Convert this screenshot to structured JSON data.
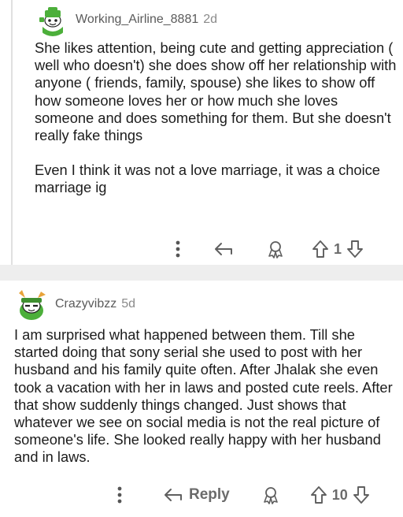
{
  "comments": [
    {
      "username": "Working_Airline_8881",
      "age": "2d",
      "paragraphs": [
        "She likes attention, being cute and getting appreciation ( well who doesn't) she does show off her relationship with anyone ( friends, family, spouse) she likes to show off how someone loves her or how much she loves someone and does something for them. But she doesn't really fake things",
        "Even I think it was not a love marriage, it was a choice marriage ig"
      ],
      "reply_label": "",
      "score": "1",
      "icons": {
        "more": "more-vertical-icon",
        "reply": "reply-arrow-icon",
        "award": "award-icon",
        "upvote": "upvote-arrow-icon",
        "downvote": "downvote-arrow-icon"
      }
    },
    {
      "username": "Crazyvibzz",
      "age": "5d",
      "paragraphs": [
        "I am surprised what happened between them. Till she started doing that sony serial she used to post with her husband and his family quite often. After Jhalak she even took a vacation with her in laws and posted cute reels. After that show suddenly things changed. Just shows that whatever we see on social media is not the real picture of someone's life. She looked really happy with her husband and in laws."
      ],
      "reply_label": "Reply",
      "score": "10",
      "icons": {
        "more": "more-vertical-icon",
        "reply": "reply-arrow-icon",
        "award": "award-icon",
        "upvote": "upvote-arrow-icon",
        "downvote": "downvote-arrow-icon"
      }
    }
  ],
  "colors": {
    "avatar_green": "#4caf3a",
    "text": "#1c1c1c",
    "meta": "#5b5b5b",
    "icon": "#6b6b6b",
    "divider": "#eeeeee"
  }
}
